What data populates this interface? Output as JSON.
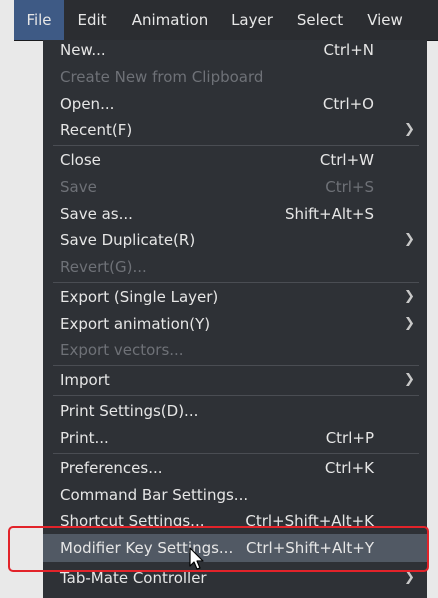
{
  "menubar": {
    "items": [
      {
        "label": "File",
        "active": true
      },
      {
        "label": "Edit"
      },
      {
        "label": "Animation"
      },
      {
        "label": "Layer"
      },
      {
        "label": "Select"
      },
      {
        "label": "View"
      }
    ]
  },
  "file_menu": {
    "new": {
      "label": "New...",
      "shortcut": "Ctrl+N"
    },
    "create_clipboard": {
      "label": "Create New from Clipboard"
    },
    "open": {
      "label": "Open...",
      "shortcut": "Ctrl+O"
    },
    "recent": {
      "label": "Recent(F)"
    },
    "close": {
      "label": "Close",
      "shortcut": "Ctrl+W"
    },
    "save": {
      "label": "Save",
      "shortcut": "Ctrl+S"
    },
    "save_as": {
      "label": "Save as...",
      "shortcut": "Shift+Alt+S"
    },
    "save_duplicate": {
      "label": "Save Duplicate(R)"
    },
    "revert": {
      "label": "Revert(G)..."
    },
    "export_single": {
      "label": "Export (Single Layer)"
    },
    "export_animation": {
      "label": "Export animation(Y)"
    },
    "export_vectors": {
      "label": "Export vectors..."
    },
    "import": {
      "label": "Import"
    },
    "print_settings": {
      "label": "Print Settings(D)..."
    },
    "print": {
      "label": "Print...",
      "shortcut": "Ctrl+P"
    },
    "preferences": {
      "label": "Preferences...",
      "shortcut": "Ctrl+K"
    },
    "command_bar": {
      "label": "Command Bar Settings..."
    },
    "shortcut_settings": {
      "label": "Shortcut Settings...",
      "shortcut": "Ctrl+Shift+Alt+K"
    },
    "modifier_key": {
      "label": "Modifier Key Settings...",
      "shortcut": "Ctrl+Shift+Alt+Y"
    },
    "tabmate": {
      "label": "Tab-Mate Controller"
    }
  },
  "colors": {
    "highlight_box": "#e2232a",
    "active_menu": "#3e5a85",
    "menu_bg": "#2e3136"
  },
  "icons": {
    "submenu": "chevron-right-icon",
    "pointer": "mouse-cursor-icon"
  }
}
